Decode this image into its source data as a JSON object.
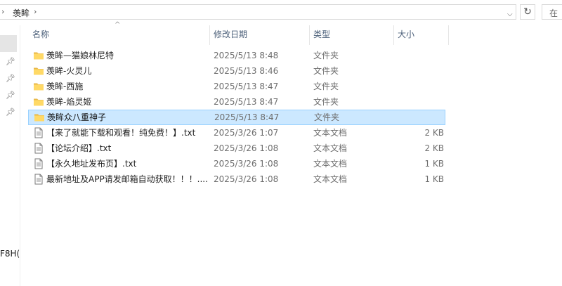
{
  "address_bar": {
    "segment": "羡眸",
    "search_placeholder": "在"
  },
  "nav": {
    "clipped_text": "F8H("
  },
  "columns": {
    "name": "名称",
    "date": "修改日期",
    "type": "类型",
    "size": "大小"
  },
  "files": [
    {
      "name": "羡眸—猫娘林尼特",
      "date": "2025/5/13 8:48",
      "type": "文件夹",
      "size": "",
      "icon": "folder-icon"
    },
    {
      "name": "羡眸-火灵儿",
      "date": "2025/5/13 8:46",
      "type": "文件夹",
      "size": "",
      "icon": "folder-icon"
    },
    {
      "name": "羡眸-西施",
      "date": "2025/5/13 8:47",
      "type": "文件夹",
      "size": "",
      "icon": "folder-icon"
    },
    {
      "name": "羡眸-焰灵姬",
      "date": "2025/5/13 8:47",
      "type": "文件夹",
      "size": "",
      "icon": "folder-icon"
    },
    {
      "name": "羡眸众八重神子",
      "date": "2025/5/13 8:47",
      "type": "文件夹",
      "size": "",
      "icon": "folder-icon",
      "selected": true
    },
    {
      "name": "【来了就能下载和观看！纯免费！】.txt",
      "date": "2025/3/26 1:07",
      "type": "文本文档",
      "size": "2 KB",
      "icon": "text-file-icon"
    },
    {
      "name": "【论坛介绍】.txt",
      "date": "2025/3/26 1:08",
      "type": "文本文档",
      "size": "2 KB",
      "icon": "text-file-icon"
    },
    {
      "name": "【永久地址发布页】.txt",
      "date": "2025/3/26 1:08",
      "type": "文本文档",
      "size": "1 KB",
      "icon": "text-file-icon"
    },
    {
      "name": "最新地址及APP请发邮箱自动获取！！！....",
      "date": "2025/3/26 1:08",
      "type": "文本文档",
      "size": "1 KB",
      "icon": "text-file-icon"
    }
  ],
  "colors": {
    "selection_bg": "#cce8ff",
    "selection_border": "#99d1ff",
    "header_text": "#4c607a",
    "folder_yellow": "#ffd966"
  }
}
